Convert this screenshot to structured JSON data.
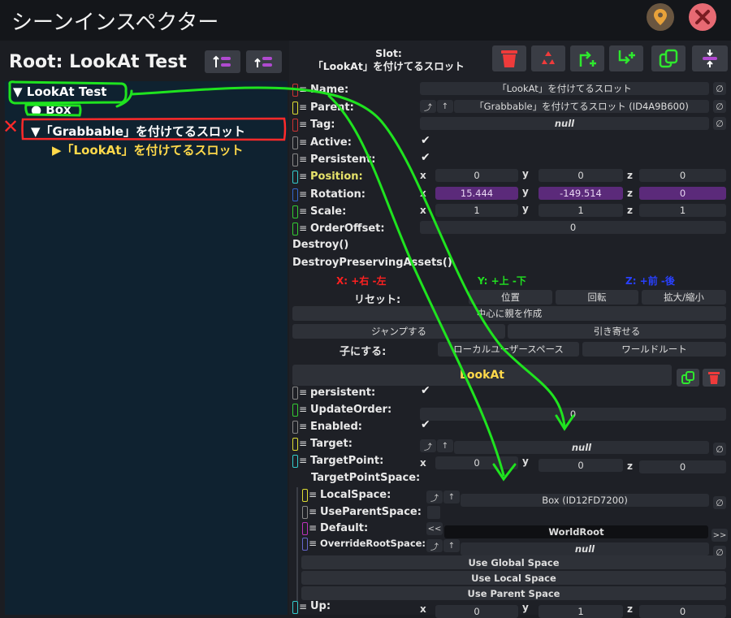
{
  "colors": {
    "accent_green": "#1fe31f",
    "error_red": "#ff2a2a",
    "gold": "#ffd94a",
    "purple_field": "#5b2a7a"
  },
  "window": {
    "title": "シーンインスペクター",
    "pin_icon": "location-pin-icon",
    "close_icon": "close-x-icon"
  },
  "hierarchy": {
    "root_title": "Root: LookAt Test",
    "items": [
      {
        "label": "▼ LookAt Test"
      },
      {
        "label": "● Box"
      },
      {
        "label": "▼「Grabbable」を付けてるスロット"
      },
      {
        "label": "▶「LookAt」を付けてるスロット"
      }
    ],
    "red_mark": "✕"
  },
  "slot_header": {
    "line1": "Slot:",
    "line2": "「LookAt」を付けてるスロット"
  },
  "fields": {
    "name": {
      "label": "Name:",
      "value": "「LookAt」を付けてるスロット"
    },
    "parent": {
      "label": "Parent:",
      "value": "「Grabbable」を付けてるスロット (ID4A9B600)"
    },
    "tag": {
      "label": "Tag:",
      "value": "null"
    },
    "active": {
      "label": "Active:"
    },
    "persistent": {
      "label": "Persistent:"
    },
    "position": {
      "label": "Position:",
      "x": "0",
      "y": "0",
      "z": "0"
    },
    "rotation": {
      "label": "Rotation:",
      "x": "15.444",
      "y": "-149.514",
      "z": "0"
    },
    "scale": {
      "label": "Scale:",
      "x": "1",
      "y": "1",
      "z": "1"
    },
    "order_offset": {
      "label": "OrderOffset:",
      "value": "0"
    }
  },
  "actions": {
    "destroy": "Destroy()",
    "destroy_preserving": "DestroyPreservingAssets()"
  },
  "axes_hint": {
    "x": "X: +右 -左",
    "y": "Y: +上 -下",
    "z": "Z: +前 -後"
  },
  "reset": {
    "label": "リセット:",
    "position": "位置",
    "rotation": "回転",
    "scale": "拡大/縮小"
  },
  "create_parent": "中心に親を作成",
  "jump": "ジャンプする",
  "pull": "引き寄せる",
  "make_child": {
    "label": "子にする:",
    "local_user_space": "ローカルユーザースペース",
    "world_root": "ワールドルート"
  },
  "component": {
    "name": "LookAt",
    "persistent": {
      "label": "persistent:"
    },
    "update_order": {
      "label": "UpdateOrder:",
      "value": "0"
    },
    "enabled": {
      "label": "Enabled:"
    },
    "target": {
      "label": "Target:",
      "value": "null"
    },
    "target_point": {
      "label": "TargetPoint:",
      "x": "0",
      "y": "0",
      "z": "0"
    },
    "target_point_space": {
      "label": "TargetPointSpace:"
    },
    "local_space": {
      "label": "LocalSpace:",
      "value": "Box (ID12FD7200)"
    },
    "use_parent_space": {
      "label": "UseParentSpace:"
    },
    "default": {
      "label": "Default:",
      "value": "WorldRoot"
    },
    "override_root_space": {
      "label": "OverrideRootSpace:",
      "value": "null"
    },
    "use_global": "Use Global Space",
    "use_local": "Use Local Space",
    "use_parent": "Use Parent Space",
    "up": {
      "label": "Up:",
      "x": "0",
      "y": "1",
      "z": "0"
    }
  },
  "axis_letters": {
    "x": "x",
    "y": "y",
    "z": "z"
  },
  "ptr_glyph": "⤴",
  "up_glyph": "↑",
  "null_glyph": "∅",
  "check_glyph": "✔",
  "left_glyph": "<<",
  "right_glyph": ">>",
  "eq_glyph": "≡"
}
